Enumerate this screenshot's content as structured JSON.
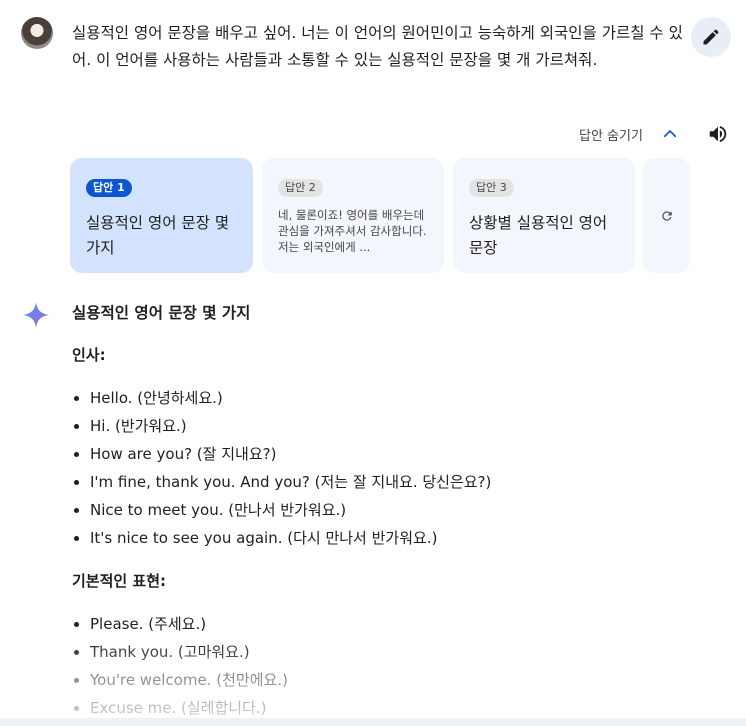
{
  "user_prompt": "실용적인 영어 문장을 배우고 싶어. 너는 이 언어의 원어민이고 능숙하게 외국인을 가르칠 수 있어. 이 언어를 사용하는 사람들과 소통할 수 있는 실용적인 문장을 몇 개 가르쳐줘.",
  "drafts_toggle_label": "답안 숨기기",
  "drafts": [
    {
      "badge": "답안 1",
      "title": "실용적인 영어 문장 몇 가지"
    },
    {
      "badge": "답안 2",
      "text": "네, 물론이죠! 영어를 배우는데 관심을 가져주셔서 감사합니다. 저는 외국인에게 ..."
    },
    {
      "badge": "답안 3",
      "title": "상황별 실용적인 영어 문장"
    }
  ],
  "answer": {
    "title": "실용적인 영어 문장 몇 가지",
    "sections": [
      {
        "heading": "인사:",
        "items": [
          "Hello. (안녕하세요.)",
          "Hi. (반가워요.)",
          "How are you? (잘 지내요?)",
          "I'm fine, thank you. And you? (저는 잘 지내요. 당신은요?)",
          "Nice to meet you. (만나서 반가워요.)",
          "It's nice to see you again. (다시 만나서 반가워요.)"
        ]
      },
      {
        "heading": "기본적인 표현:",
        "items": [
          "Please. (주세요.)",
          "Thank you. (고마워요.)",
          "You're welcome. (천만에요.)",
          "Excuse me. (실례합니다.)"
        ]
      }
    ]
  },
  "colors": {
    "active_draft_bg": "#d3e3fd",
    "draft_bg": "#f3f6fc",
    "accent": "#0b57d0"
  }
}
